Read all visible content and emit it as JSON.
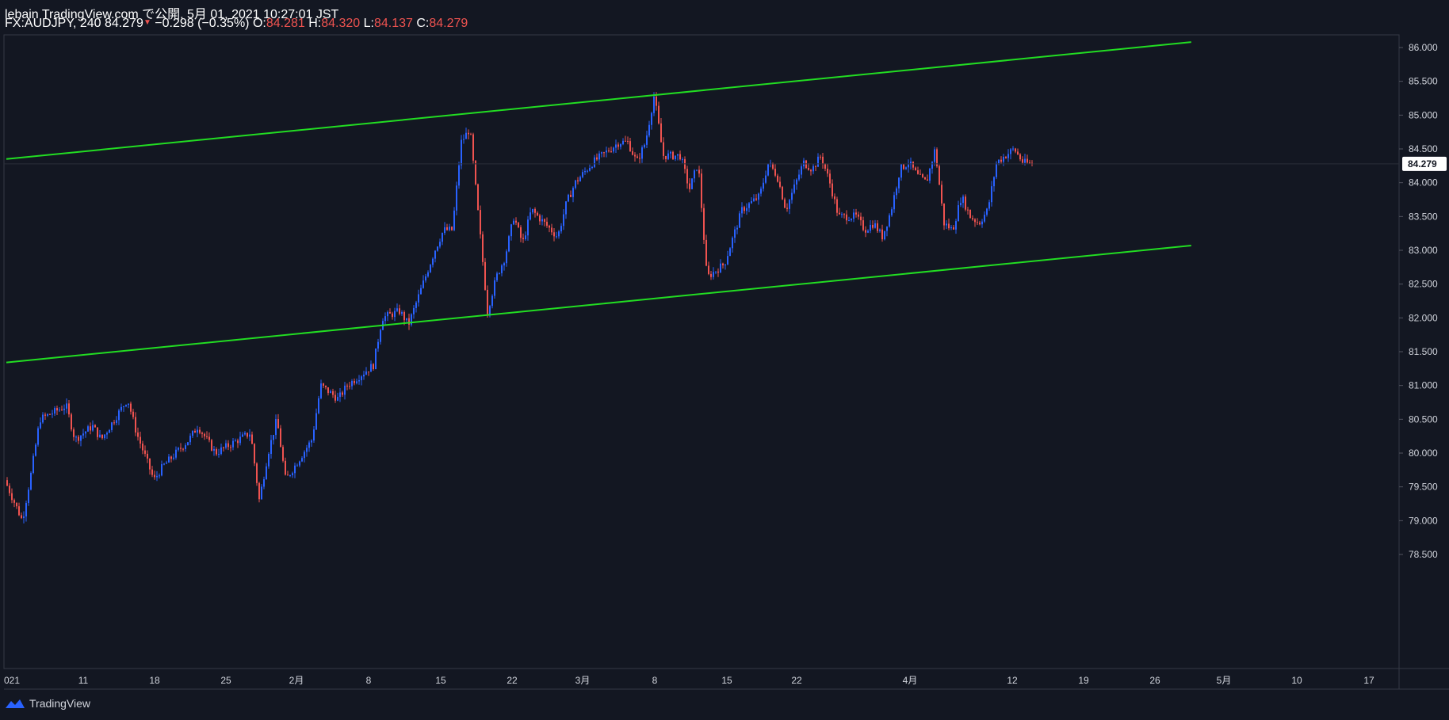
{
  "header": {
    "publish": "lebain TradingView.com で公開, 5月 01, 2021 10:27:01 JST",
    "symbol": "FX:AUDJPY, 240",
    "last": "84.279",
    "change": "−0.298 (−0.35%)",
    "o_label": "O:",
    "o_val": "84.281",
    "h_label": "H:",
    "h_val": "84.320",
    "l_label": "L:",
    "l_val": "84.137",
    "c_label": "C:",
    "c_val": "84.279"
  },
  "footer": {
    "brand": "TradingView"
  },
  "chart_data": {
    "type": "candlestick",
    "symbol": "FX:AUDJPY",
    "interval": "240",
    "colors": {
      "up": "#2962ff",
      "down": "#ef5350",
      "trendline": "#22dd22",
      "background": "#131722",
      "price_badge": "#ffffff"
    },
    "ylim": [
      78.2,
      86.3
    ],
    "y_ticks": [
      "86.000",
      "85.500",
      "85.000",
      "84.500",
      "84.000",
      "83.500",
      "83.000",
      "82.500",
      "82.000",
      "81.500",
      "81.000",
      "80.500",
      "80.000",
      "79.500",
      "79.000",
      "78.500"
    ],
    "x_ticks": [
      "021",
      "11",
      "18",
      "25",
      "2月",
      "8",
      "15",
      "22",
      "3月",
      "8",
      "15",
      "22",
      "4月",
      "12",
      "19",
      "26",
      "5月",
      "10",
      "17"
    ],
    "last_price_label": "84.279",
    "trendlines": [
      {
        "name": "upper",
        "start": [
          "2021-01-04",
          84.35
        ],
        "end": [
          "2021-05-19",
          86.08
        ]
      },
      {
        "name": "lower",
        "start": [
          "2021-01-04",
          81.34
        ],
        "end": [
          "2021-05-19",
          83.07
        ]
      }
    ],
    "anchors": [
      [
        "2021-01-04",
        79.6
      ],
      [
        "2021-01-06",
        79.0
      ],
      [
        "2021-01-07",
        79.7
      ],
      [
        "2021-01-08",
        80.5
      ],
      [
        "2021-01-11",
        80.7
      ],
      [
        "2021-01-12",
        80.2
      ],
      [
        "2021-01-14",
        80.4
      ],
      [
        "2021-01-15",
        80.2
      ],
      [
        "2021-01-18",
        80.8
      ],
      [
        "2021-01-19",
        80.3
      ],
      [
        "2021-01-21",
        79.6
      ],
      [
        "2021-01-22",
        79.8
      ],
      [
        "2021-01-25",
        80.2
      ],
      [
        "2021-01-26",
        80.4
      ],
      [
        "2021-01-28",
        80.0
      ],
      [
        "2021-02-01",
        80.3
      ],
      [
        "2021-02-02",
        79.3
      ],
      [
        "2021-02-03",
        80.0
      ],
      [
        "2021-02-04",
        80.5
      ],
      [
        "2021-02-05",
        79.6
      ],
      [
        "2021-02-08",
        80.2
      ],
      [
        "2021-02-09",
        81.0
      ],
      [
        "2021-02-11",
        80.8
      ],
      [
        "2021-02-12",
        81.0
      ],
      [
        "2021-02-15",
        81.3
      ],
      [
        "2021-02-16",
        82.0
      ],
      [
        "2021-02-18",
        82.1
      ],
      [
        "2021-02-19",
        81.9
      ],
      [
        "2021-02-22",
        83.0
      ],
      [
        "2021-02-23",
        83.3
      ],
      [
        "2021-02-24",
        83.3
      ],
      [
        "2021-02-25",
        84.6
      ],
      [
        "2021-02-26",
        84.8
      ],
      [
        "2021-02-28",
        82.1
      ],
      [
        "2021-03-01",
        82.6
      ],
      [
        "2021-03-02",
        82.9
      ],
      [
        "2021-03-03",
        83.5
      ],
      [
        "2021-03-04",
        83.1
      ],
      [
        "2021-03-05",
        83.6
      ],
      [
        "2021-03-08",
        83.2
      ],
      [
        "2021-03-09",
        83.7
      ],
      [
        "2021-03-10",
        84.0
      ],
      [
        "2021-03-12",
        84.3
      ],
      [
        "2021-03-14",
        84.5
      ],
      [
        "2021-03-15",
        84.6
      ],
      [
        "2021-03-16",
        84.6
      ],
      [
        "2021-03-17",
        84.3
      ],
      [
        "2021-03-18",
        84.6
      ],
      [
        "2021-03-19",
        85.3
      ],
      [
        "2021-03-20",
        84.4
      ],
      [
        "2021-03-22",
        84.4
      ],
      [
        "2021-03-23",
        83.9
      ],
      [
        "2021-03-24",
        84.3
      ],
      [
        "2021-03-25",
        82.6
      ],
      [
        "2021-03-26",
        82.7
      ],
      [
        "2021-03-27",
        82.8
      ],
      [
        "2021-03-29",
        83.6
      ],
      [
        "2021-03-31",
        83.8
      ],
      [
        "2021-04-01",
        84.3
      ],
      [
        "2021-04-02",
        84.1
      ],
      [
        "2021-04-03",
        83.6
      ],
      [
        "2021-04-05",
        84.3
      ],
      [
        "2021-04-06",
        84.2
      ],
      [
        "2021-04-07",
        84.4
      ],
      [
        "2021-04-08",
        84.0
      ],
      [
        "2021-04-09",
        83.5
      ],
      [
        "2021-04-11",
        83.5
      ],
      [
        "2021-04-12",
        83.3
      ],
      [
        "2021-04-13",
        83.4
      ],
      [
        "2021-04-14",
        83.2
      ],
      [
        "2021-04-15",
        83.6
      ],
      [
        "2021-04-16",
        84.2
      ],
      [
        "2021-04-17",
        84.3
      ],
      [
        "2021-04-18",
        84.1
      ],
      [
        "2021-04-19",
        84.0
      ],
      [
        "2021-04-20",
        84.5
      ],
      [
        "2021-04-21",
        83.4
      ],
      [
        "2021-04-22",
        83.3
      ],
      [
        "2021-04-23",
        83.8
      ],
      [
        "2021-04-24",
        83.5
      ],
      [
        "2021-04-25",
        83.4
      ],
      [
        "2021-04-26",
        83.6
      ],
      [
        "2021-04-27",
        84.3
      ],
      [
        "2021-04-28",
        84.4
      ],
      [
        "2021-04-29",
        84.5
      ],
      [
        "2021-04-30",
        84.3
      ],
      [
        "2021-04-30T20:00",
        84.279
      ]
    ]
  }
}
